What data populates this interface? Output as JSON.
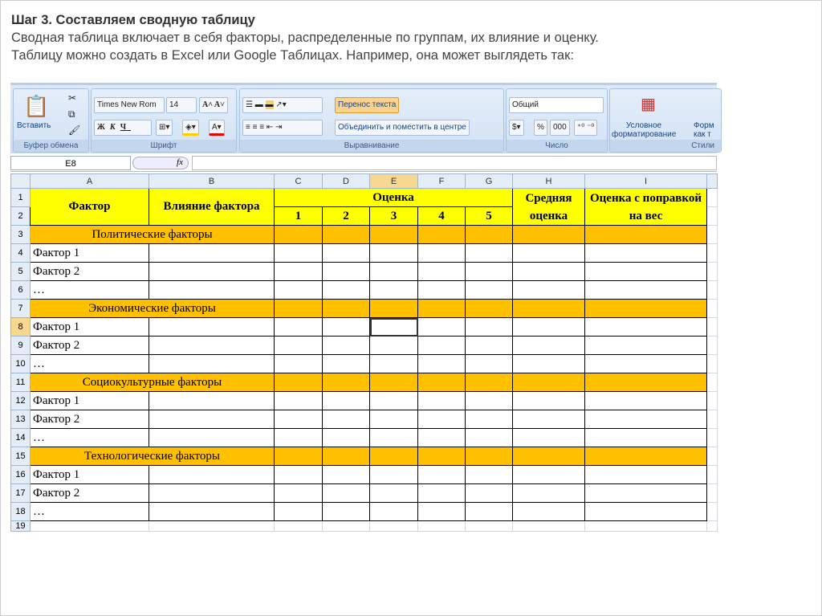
{
  "intro": {
    "title": "Шаг 3. Составляем сводную таблицу",
    "line1": "Сводная таблица включает в себя факторы, распределенные по группам, их влияние и оценку.",
    "line2": "Таблицу можно создать в Excel или Google Таблицах. Например, она может выглядеть так:"
  },
  "ribbon": {
    "paste": "Вставить",
    "clipboard": "Буфер обмена",
    "font_name": "Times New Rom",
    "font_size": "14",
    "bold": "Ж",
    "italic": "К",
    "underline": "Ч",
    "font_group": "Шрифт",
    "wrap": "Перенос текста",
    "merge": "Объединить и поместить в центре",
    "align_group": "Выравнивание",
    "number_format": "Общий",
    "percent": "%",
    "thousands": "000",
    "number_group": "Число",
    "cond_format1": "Условное",
    "cond_format2": "форматирование",
    "format_table1": "Форм",
    "format_table2": "как т",
    "styles_group": "Стили"
  },
  "formula": {
    "cell": "E8",
    "fx": "fx",
    "value": ""
  },
  "columns": [
    "A",
    "B",
    "C",
    "D",
    "E",
    "F",
    "G",
    "H",
    "I"
  ],
  "header": {
    "factor": "Фактор",
    "influence": "Влияние фактора",
    "score": "Оценка",
    "scores": [
      "1",
      "2",
      "3",
      "4",
      "5"
    ],
    "avg": "Средняя оценка",
    "weighted": "Оценка с поправкой на вес"
  },
  "groups": [
    {
      "title": "Политические факторы",
      "items": [
        "Фактор 1",
        "Фактор 2",
        "…"
      ]
    },
    {
      "title": "Экономические факторы",
      "items": [
        "Фактор 1",
        "Фактор 2",
        "…"
      ]
    },
    {
      "title": "Социокультурные факторы",
      "items": [
        "Фактор 1",
        "Фактор 2",
        "…"
      ]
    },
    {
      "title": "Технологические факторы",
      "items": [
        "Фактор 1",
        "Фактор 2",
        "…"
      ]
    }
  ],
  "rows": [
    "1",
    "2",
    "3",
    "4",
    "5",
    "6",
    "7",
    "8",
    "9",
    "10",
    "11",
    "12",
    "13",
    "14",
    "15",
    "16",
    "17",
    "18",
    "19"
  ]
}
